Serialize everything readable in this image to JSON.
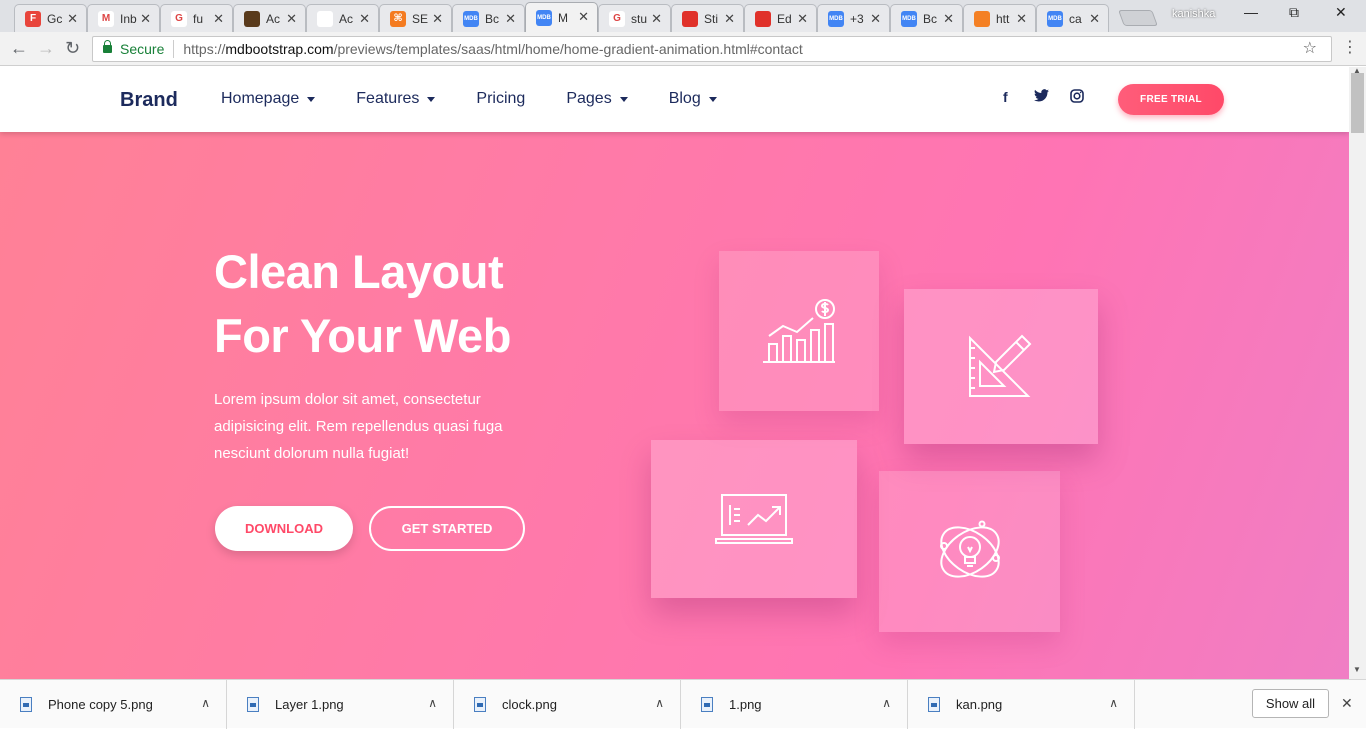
{
  "browser": {
    "tabs": [
      {
        "title": "Gc",
        "favicon_color": "#e8453c",
        "favicon_glyph": "F"
      },
      {
        "title": "Inb",
        "favicon_color": "#ffffff",
        "favicon_glyph": "M"
      },
      {
        "title": "fu",
        "favicon_color": "#ffffff",
        "favicon_glyph": "G"
      },
      {
        "title": "Ac",
        "favicon_color": "#5a3b1c",
        "favicon_glyph": ""
      },
      {
        "title": "Ac",
        "favicon_color": "#ffffff",
        "favicon_glyph": ""
      },
      {
        "title": "SE",
        "favicon_color": "#f47b20",
        "favicon_glyph": "⌘"
      },
      {
        "title": "Bc",
        "favicon_color": "#4285f4",
        "favicon_glyph": "MDB"
      },
      {
        "title": "M",
        "favicon_color": "#4285f4",
        "favicon_glyph": "MDB"
      },
      {
        "title": "stu",
        "favicon_color": "#ffffff",
        "favicon_glyph": "G"
      },
      {
        "title": "Sti",
        "favicon_color": "#e0312a",
        "favicon_glyph": ""
      },
      {
        "title": "Ed",
        "favicon_color": "#e0312a",
        "favicon_glyph": ""
      },
      {
        "title": "+3",
        "favicon_color": "#4285f4",
        "favicon_glyph": "MDB"
      },
      {
        "title": "Bc",
        "favicon_color": "#4285f4",
        "favicon_glyph": "MDB"
      },
      {
        "title": "htt",
        "favicon_color": "#f48024",
        "favicon_glyph": ""
      },
      {
        "title": "ca",
        "favicon_color": "#4285f4",
        "favicon_glyph": "MDB"
      }
    ],
    "active_tab_index": 7,
    "profile_name": "kanishka",
    "secure_label": "Secure",
    "url_scheme": "https://",
    "url_host": "mdbootstrap.com",
    "url_path": "/previews/templates/saas/html/home/home-gradient-animation.html#contact"
  },
  "site": {
    "brand": "Brand",
    "nav": [
      {
        "label": "Homepage",
        "dropdown": true
      },
      {
        "label": "Features",
        "dropdown": true
      },
      {
        "label": "Pricing",
        "dropdown": false
      },
      {
        "label": "Pages",
        "dropdown": true
      },
      {
        "label": "Blog",
        "dropdown": true
      }
    ],
    "social_icons": [
      "facebook-icon",
      "twitter-icon",
      "instagram-icon"
    ],
    "free_trial_label": "FREE TRIAL",
    "accent_color": "#ff4968"
  },
  "hero": {
    "title_line1": "Clean Layout",
    "title_line2": "For Your Web",
    "lead_line1": "Lorem ipsum dolor sit amet, consectetur",
    "lead_line2": "adipisicing elit. Rem repellendus quasi fuga",
    "lead_line3": "nesciunt dolorum nulla fugiat!",
    "download_label": "DOWNLOAD",
    "get_started_label": "GET STARTED",
    "cards": [
      "growth-chart-icon",
      "design-tools-icon",
      "analytics-screen-icon",
      "idea-bulb-icon"
    ]
  },
  "downloads": {
    "items": [
      "Phone copy 5.png",
      "Layer 1.png",
      "clock.png",
      "1.png",
      "kan.png"
    ],
    "show_all_label": "Show all"
  }
}
